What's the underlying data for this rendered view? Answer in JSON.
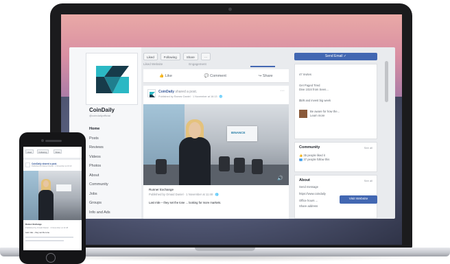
{
  "page": {
    "name": "CoinDaily",
    "handle": "@coindailyofficial",
    "nav": [
      "Home",
      "Posts",
      "Reviews",
      "Videos",
      "Photos",
      "About",
      "Community",
      "Jobs",
      "Groups",
      "Info and Ads"
    ]
  },
  "actions": {
    "liked": "Liked",
    "following": "Following",
    "share": "Share",
    "more": "···"
  },
  "subtabs": [
    "Liked Website",
    "Engagement"
  ],
  "like_bar": {
    "like": "Like",
    "comment": "Comment",
    "share": "Share"
  },
  "post": {
    "author": "CoinDaily",
    "action": "shared a post.",
    "meta": "Published by Ramez Daniel · 1 November at 16:13 · 🌐",
    "dots": "···",
    "video_sign": "BINANCE",
    "volume_icon": "🔊",
    "shared_title": "Runner Exchange",
    "shared_meta": "Published by Omaid Daniel · 1 November at 11:48 · 🌐",
    "body": "Last mile – they set the tone ... looking for more markets."
  },
  "sidebar_right": {
    "send_button": "Send Email ✓",
    "stats": [
      "47 Invites",
      "Get Paged Tired",
      "Dive 1024 from Seen... ",
      "$5/8 and invest big week"
    ],
    "ad_line1": "Be aware for how the...",
    "ad_line2": "Learn more",
    "community_title": "Community",
    "see_all": "See all",
    "community_items": [
      "35 people liked it",
      "37 people follow this"
    ],
    "about_title": "About",
    "about_see_all": "See all",
    "about_items": [
      "Send message",
      "https://www.coindaily",
      "Office hours ...",
      "Share address"
    ],
    "visit_button": "Visit Website"
  },
  "phone": {
    "pills": [
      "Liked",
      "Following",
      "Share"
    ],
    "author": "CoinDaily shared a post.",
    "meta": "Published by Ramez Daniel · 1 November at 16:13",
    "shared_title": "Runner Exchange",
    "shared_meta": "Published by Omaid Daniel · 1 November at 11:48",
    "body": "Last mile – they set the tone."
  }
}
